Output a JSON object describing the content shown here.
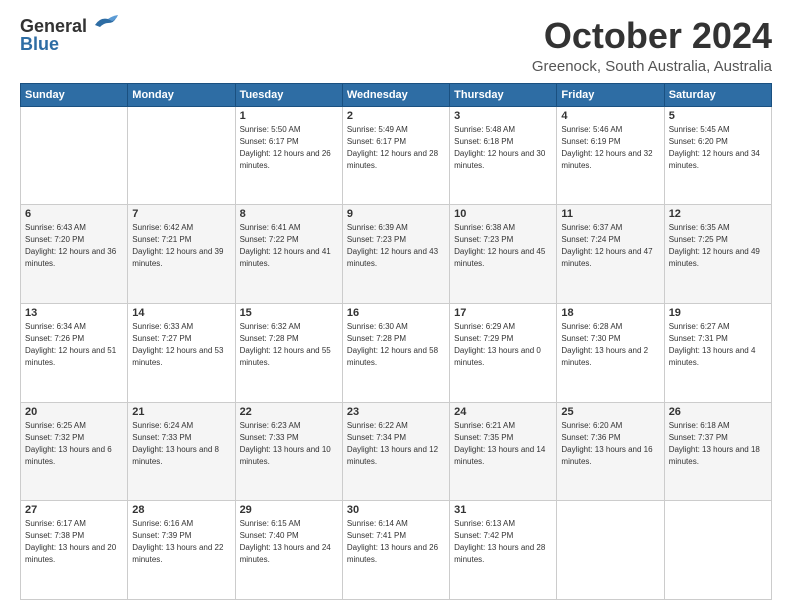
{
  "header": {
    "logo_line1": "General",
    "logo_line2": "Blue",
    "month": "October 2024",
    "location": "Greenock, South Australia, Australia"
  },
  "weekdays": [
    "Sunday",
    "Monday",
    "Tuesday",
    "Wednesday",
    "Thursday",
    "Friday",
    "Saturday"
  ],
  "weeks": [
    [
      {
        "day": "",
        "sunrise": "",
        "sunset": "",
        "daylight": ""
      },
      {
        "day": "",
        "sunrise": "",
        "sunset": "",
        "daylight": ""
      },
      {
        "day": "1",
        "sunrise": "Sunrise: 5:50 AM",
        "sunset": "Sunset: 6:17 PM",
        "daylight": "Daylight: 12 hours and 26 minutes."
      },
      {
        "day": "2",
        "sunrise": "Sunrise: 5:49 AM",
        "sunset": "Sunset: 6:17 PM",
        "daylight": "Daylight: 12 hours and 28 minutes."
      },
      {
        "day": "3",
        "sunrise": "Sunrise: 5:48 AM",
        "sunset": "Sunset: 6:18 PM",
        "daylight": "Daylight: 12 hours and 30 minutes."
      },
      {
        "day": "4",
        "sunrise": "Sunrise: 5:46 AM",
        "sunset": "Sunset: 6:19 PM",
        "daylight": "Daylight: 12 hours and 32 minutes."
      },
      {
        "day": "5",
        "sunrise": "Sunrise: 5:45 AM",
        "sunset": "Sunset: 6:20 PM",
        "daylight": "Daylight: 12 hours and 34 minutes."
      }
    ],
    [
      {
        "day": "6",
        "sunrise": "Sunrise: 6:43 AM",
        "sunset": "Sunset: 7:20 PM",
        "daylight": "Daylight: 12 hours and 36 minutes."
      },
      {
        "day": "7",
        "sunrise": "Sunrise: 6:42 AM",
        "sunset": "Sunset: 7:21 PM",
        "daylight": "Daylight: 12 hours and 39 minutes."
      },
      {
        "day": "8",
        "sunrise": "Sunrise: 6:41 AM",
        "sunset": "Sunset: 7:22 PM",
        "daylight": "Daylight: 12 hours and 41 minutes."
      },
      {
        "day": "9",
        "sunrise": "Sunrise: 6:39 AM",
        "sunset": "Sunset: 7:23 PM",
        "daylight": "Daylight: 12 hours and 43 minutes."
      },
      {
        "day": "10",
        "sunrise": "Sunrise: 6:38 AM",
        "sunset": "Sunset: 7:23 PM",
        "daylight": "Daylight: 12 hours and 45 minutes."
      },
      {
        "day": "11",
        "sunrise": "Sunrise: 6:37 AM",
        "sunset": "Sunset: 7:24 PM",
        "daylight": "Daylight: 12 hours and 47 minutes."
      },
      {
        "day": "12",
        "sunrise": "Sunrise: 6:35 AM",
        "sunset": "Sunset: 7:25 PM",
        "daylight": "Daylight: 12 hours and 49 minutes."
      }
    ],
    [
      {
        "day": "13",
        "sunrise": "Sunrise: 6:34 AM",
        "sunset": "Sunset: 7:26 PM",
        "daylight": "Daylight: 12 hours and 51 minutes."
      },
      {
        "day": "14",
        "sunrise": "Sunrise: 6:33 AM",
        "sunset": "Sunset: 7:27 PM",
        "daylight": "Daylight: 12 hours and 53 minutes."
      },
      {
        "day": "15",
        "sunrise": "Sunrise: 6:32 AM",
        "sunset": "Sunset: 7:28 PM",
        "daylight": "Daylight: 12 hours and 55 minutes."
      },
      {
        "day": "16",
        "sunrise": "Sunrise: 6:30 AM",
        "sunset": "Sunset: 7:28 PM",
        "daylight": "Daylight: 12 hours and 58 minutes."
      },
      {
        "day": "17",
        "sunrise": "Sunrise: 6:29 AM",
        "sunset": "Sunset: 7:29 PM",
        "daylight": "Daylight: 13 hours and 0 minutes."
      },
      {
        "day": "18",
        "sunrise": "Sunrise: 6:28 AM",
        "sunset": "Sunset: 7:30 PM",
        "daylight": "Daylight: 13 hours and 2 minutes."
      },
      {
        "day": "19",
        "sunrise": "Sunrise: 6:27 AM",
        "sunset": "Sunset: 7:31 PM",
        "daylight": "Daylight: 13 hours and 4 minutes."
      }
    ],
    [
      {
        "day": "20",
        "sunrise": "Sunrise: 6:25 AM",
        "sunset": "Sunset: 7:32 PM",
        "daylight": "Daylight: 13 hours and 6 minutes."
      },
      {
        "day": "21",
        "sunrise": "Sunrise: 6:24 AM",
        "sunset": "Sunset: 7:33 PM",
        "daylight": "Daylight: 13 hours and 8 minutes."
      },
      {
        "day": "22",
        "sunrise": "Sunrise: 6:23 AM",
        "sunset": "Sunset: 7:33 PM",
        "daylight": "Daylight: 13 hours and 10 minutes."
      },
      {
        "day": "23",
        "sunrise": "Sunrise: 6:22 AM",
        "sunset": "Sunset: 7:34 PM",
        "daylight": "Daylight: 13 hours and 12 minutes."
      },
      {
        "day": "24",
        "sunrise": "Sunrise: 6:21 AM",
        "sunset": "Sunset: 7:35 PM",
        "daylight": "Daylight: 13 hours and 14 minutes."
      },
      {
        "day": "25",
        "sunrise": "Sunrise: 6:20 AM",
        "sunset": "Sunset: 7:36 PM",
        "daylight": "Daylight: 13 hours and 16 minutes."
      },
      {
        "day": "26",
        "sunrise": "Sunrise: 6:18 AM",
        "sunset": "Sunset: 7:37 PM",
        "daylight": "Daylight: 13 hours and 18 minutes."
      }
    ],
    [
      {
        "day": "27",
        "sunrise": "Sunrise: 6:17 AM",
        "sunset": "Sunset: 7:38 PM",
        "daylight": "Daylight: 13 hours and 20 minutes."
      },
      {
        "day": "28",
        "sunrise": "Sunrise: 6:16 AM",
        "sunset": "Sunset: 7:39 PM",
        "daylight": "Daylight: 13 hours and 22 minutes."
      },
      {
        "day": "29",
        "sunrise": "Sunrise: 6:15 AM",
        "sunset": "Sunset: 7:40 PM",
        "daylight": "Daylight: 13 hours and 24 minutes."
      },
      {
        "day": "30",
        "sunrise": "Sunrise: 6:14 AM",
        "sunset": "Sunset: 7:41 PM",
        "daylight": "Daylight: 13 hours and 26 minutes."
      },
      {
        "day": "31",
        "sunrise": "Sunrise: 6:13 AM",
        "sunset": "Sunset: 7:42 PM",
        "daylight": "Daylight: 13 hours and 28 minutes."
      },
      {
        "day": "",
        "sunrise": "",
        "sunset": "",
        "daylight": ""
      },
      {
        "day": "",
        "sunrise": "",
        "sunset": "",
        "daylight": ""
      }
    ]
  ]
}
